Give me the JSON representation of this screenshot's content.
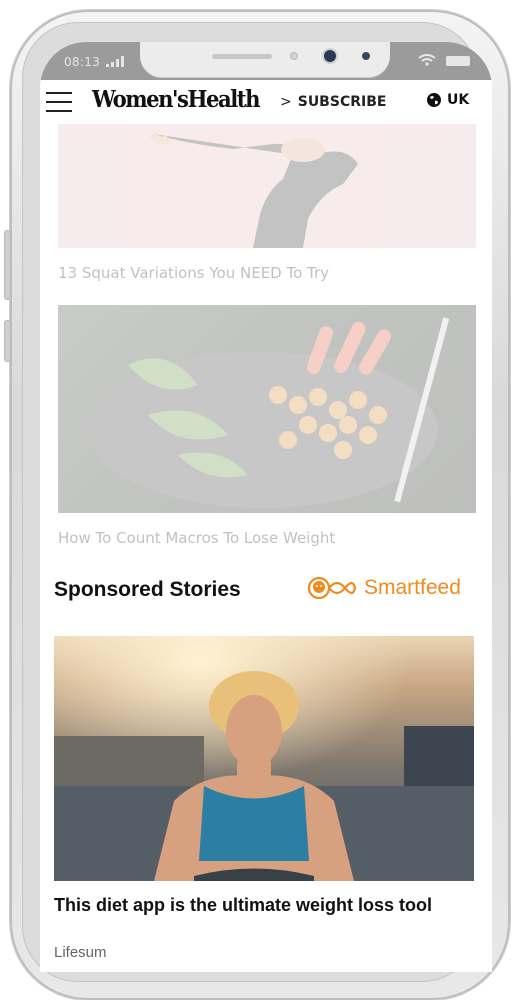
{
  "status": {
    "time": "08:13"
  },
  "header": {
    "logo": "Women'sHealth",
    "subscribe_label": "SUBSCRIBE",
    "region_label": "UK"
  },
  "articles": [
    {
      "title": "13 Squat Variations You NEED To Try"
    },
    {
      "title": "How To Count Macros To Lose Weight"
    }
  ],
  "sponsored": {
    "heading": "Sponsored Stories",
    "provider": "Smartfeed",
    "story": {
      "title": "This diet app is the ultimate weight loss tool",
      "source": "Lifesum"
    }
  },
  "colors": {
    "accent": "#f08a1c",
    "statusbar": "#9b9b9b"
  }
}
